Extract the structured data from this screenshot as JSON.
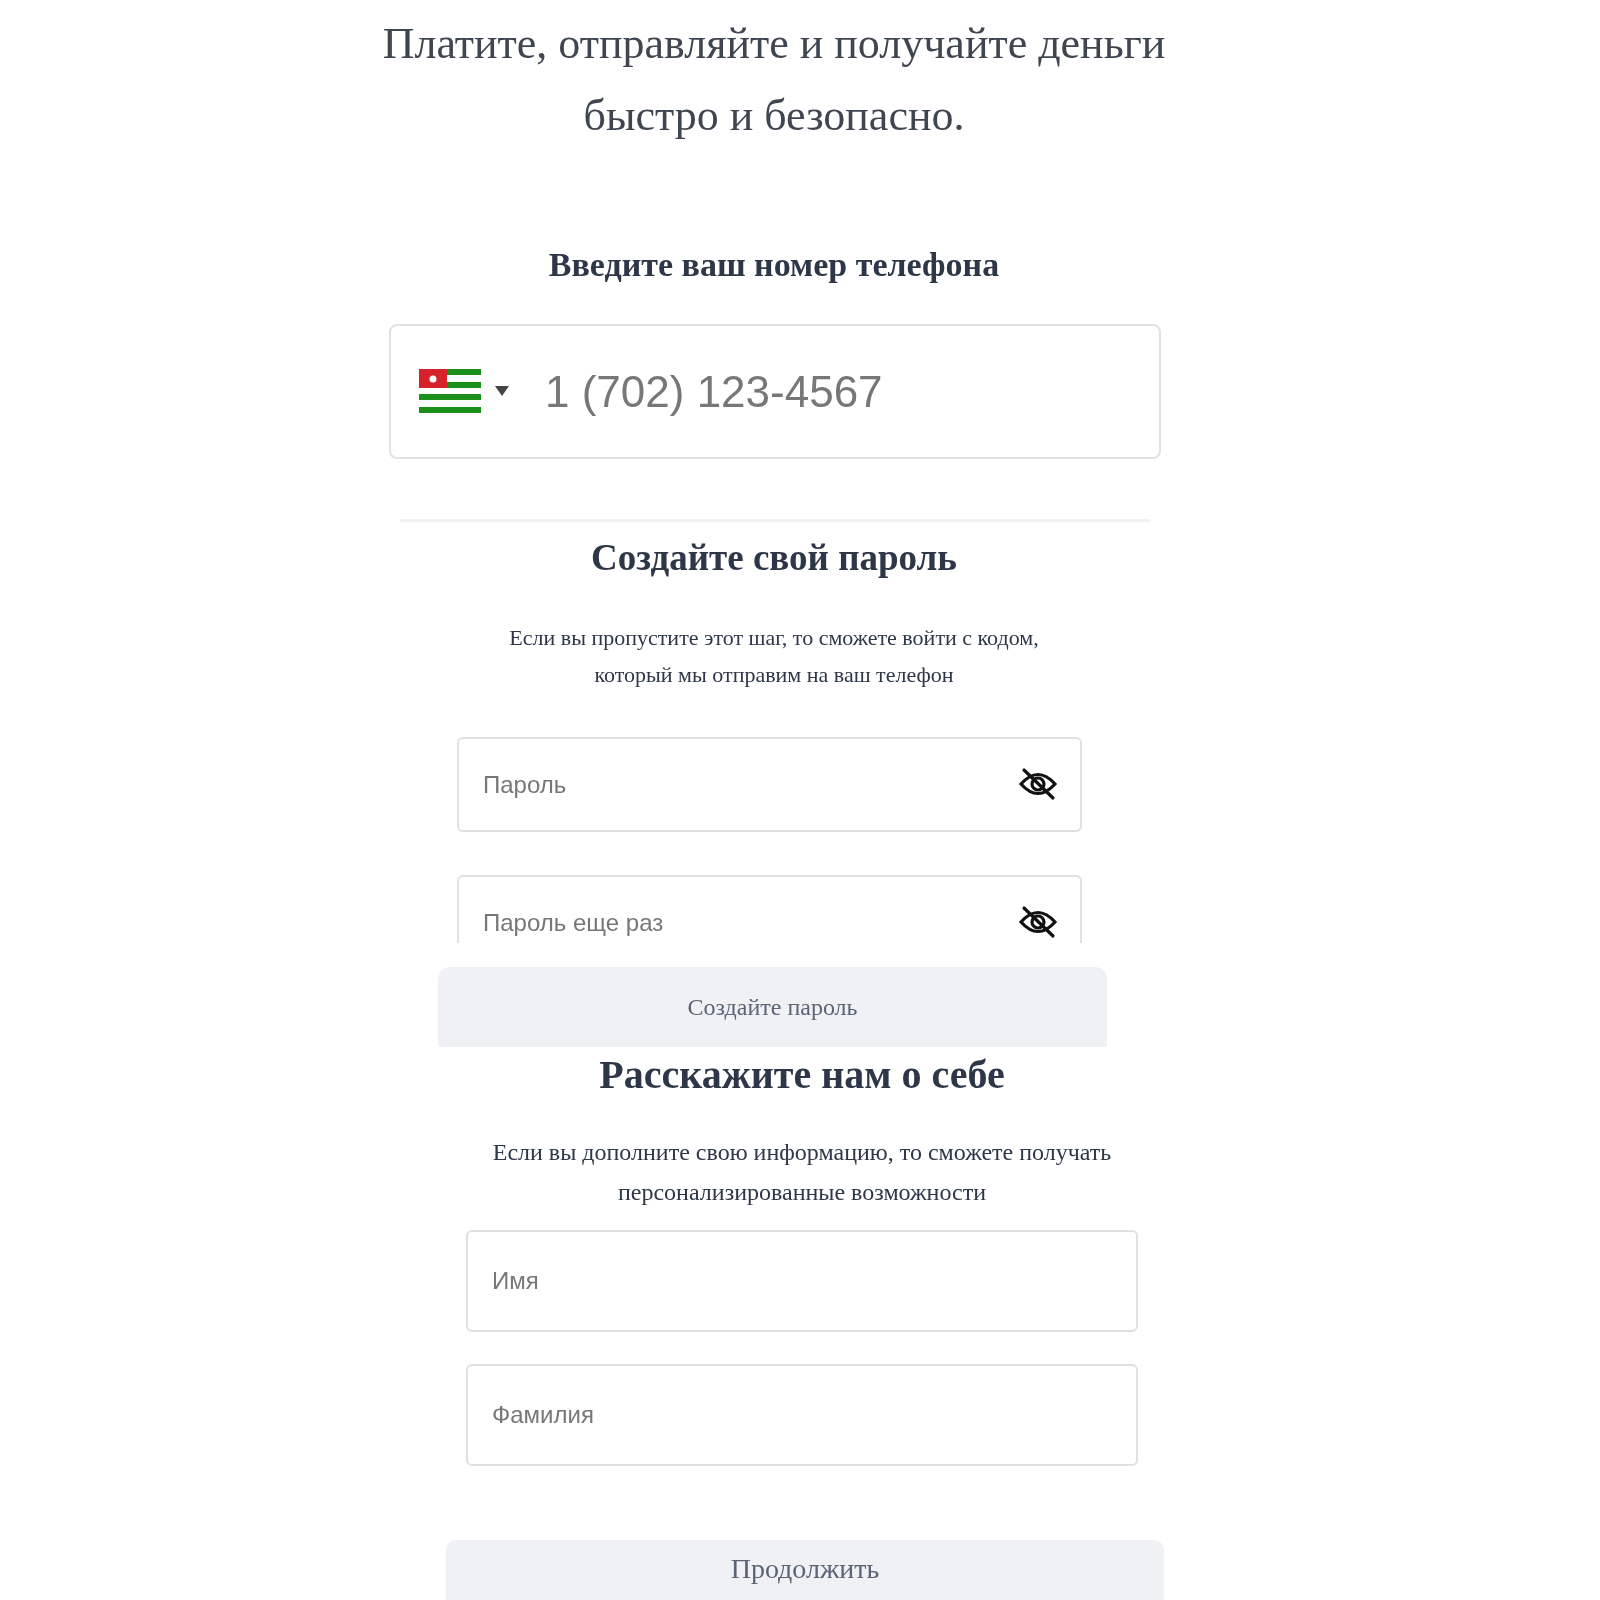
{
  "title": [
    "Платите, отправляйте и получайте деньги",
    "быстро и безопасно."
  ],
  "phone_section": {
    "heading": "Введите ваш номер телефона",
    "phone": {
      "placeholder": "1 (702) 123-4567"
    }
  },
  "password_section": {
    "heading": "Создайте свой пароль",
    "description": [
      "Если вы пропустите этот шаг, то сможете войти с кодом,",
      "который мы отправим на ваш телефон"
    ],
    "fields": [
      {
        "placeholder": "Пароль"
      },
      {
        "placeholder": "Пароль еще раз"
      }
    ],
    "button": "Создайте пароль"
  },
  "profile_section": {
    "heading": "Расскажите нам о себе",
    "description": [
      "Если вы дополните свою информацию, то сможете получать",
      "персонализированные возможности"
    ],
    "fields": [
      {
        "placeholder": "Имя"
      },
      {
        "placeholder": "Фамилия"
      }
    ],
    "button": "Продолжить"
  }
}
